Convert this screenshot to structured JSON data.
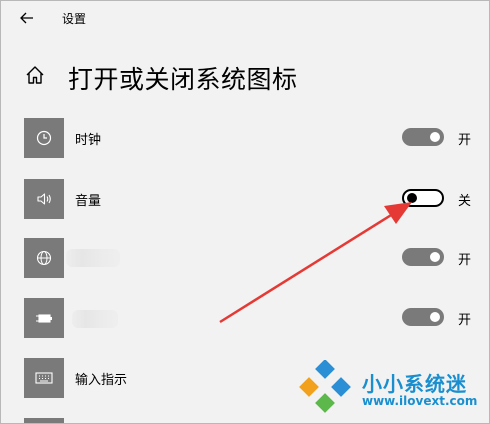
{
  "window": {
    "title": "设置"
  },
  "page": {
    "title": "打开或关闭系统图标"
  },
  "items": [
    {
      "label": "时钟",
      "state": "开",
      "on": true,
      "icon": "clock-icon"
    },
    {
      "label": "音量",
      "state": "关",
      "on": false,
      "icon": "volume-icon"
    },
    {
      "label": "",
      "state": "开",
      "on": true,
      "icon": "globe-icon"
    },
    {
      "label": "",
      "state": "开",
      "on": true,
      "icon": "power-icon"
    },
    {
      "label": "输入指示",
      "state": "",
      "on": null,
      "icon": "keyboard-icon"
    }
  ],
  "colors": {
    "accent_arrow": "#e53935",
    "toggle_on": "#7a7a7a",
    "icon_tile": "#7a7a7a",
    "watermark": "#1a8fcf"
  },
  "watermark": {
    "text": "小小系统迷",
    "url": "www.ilovext.com"
  }
}
